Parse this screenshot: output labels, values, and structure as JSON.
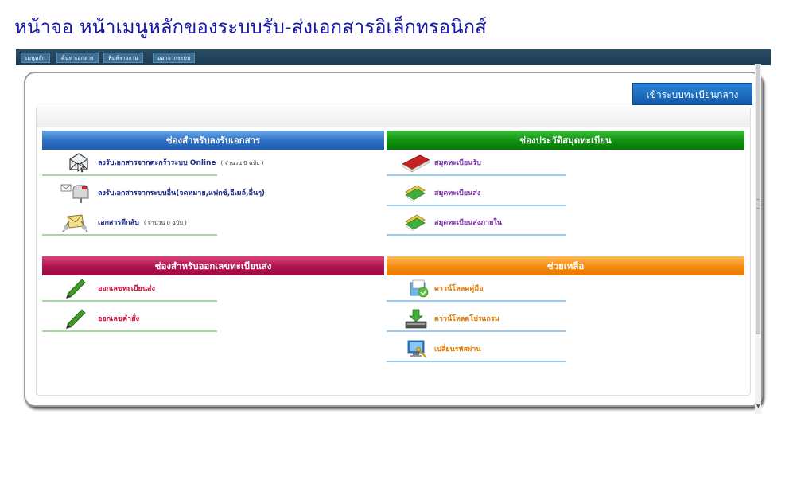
{
  "page_title": "หน้าจอ หน้าเมนูหลักของระบบรับ-ส่งเอกสารอิเล็กทรอนิกส์",
  "nav": {
    "items": [
      "เมนูหลัก",
      "ค้นหาเอกสาร",
      "พิมพ์รายงาน",
      "ออกจากระบบ"
    ]
  },
  "central_button": "เข้าระบบทะเบียนกลาง",
  "sections": {
    "receive": {
      "header": "ช่องสำหรับลงรับเอกสาร",
      "items": [
        {
          "label": "ลงรับเอกสารจากตะกร้าระบบ Online",
          "count": "( จำนวน 0 ฉบับ )"
        },
        {
          "label": "ลงรับเอกสารจากระบบอื่น(จดหมาย,แฟกซ์,อีเมล์,อื่นๆ)"
        },
        {
          "label": "เอกสารตีกลับ",
          "count": "( จำนวน 0 ฉบับ )"
        }
      ]
    },
    "registry": {
      "header": "ช่องประวัติสมุดทะเบียน",
      "items": [
        {
          "label": "สมุดทะเบียนรับ"
        },
        {
          "label": "สมุดทะเบียนส่ง"
        },
        {
          "label": "สมุดทะเบียนส่งภายใน"
        }
      ]
    },
    "issue": {
      "header": "ช่องสำหรับออกเลขทะเบียนส่ง",
      "items": [
        {
          "label": "ออกเลขทะเบียนส่ง"
        },
        {
          "label": "ออกเลขคำสั่ง"
        }
      ]
    },
    "help": {
      "header": "ช่วยเหลือ",
      "items": [
        {
          "label": "ดาวน์โหลดคู่มือ"
        },
        {
          "label": "ดาวน์โหลดโปรแกรม"
        },
        {
          "label": "เปลี่ยนรหัสผ่าน"
        }
      ]
    }
  },
  "colors": {
    "title": "#1717a8",
    "receive_header": "#2a6fc2",
    "registry_header": "#0d900d",
    "issue_header": "#b0124e",
    "help_header": "#f48a10",
    "central_button": "#1a6cc4"
  },
  "icons": {
    "receive": [
      "envelope-online-icon",
      "mailbox-icon",
      "returned-letter-icon"
    ],
    "registry": [
      "red-book-icon",
      "green-book-icon",
      "green-book-icon"
    ],
    "issue": [
      "pencil-icon",
      "pencil-icon"
    ],
    "help": [
      "manual-download-icon",
      "program-download-icon",
      "change-password-icon"
    ]
  }
}
